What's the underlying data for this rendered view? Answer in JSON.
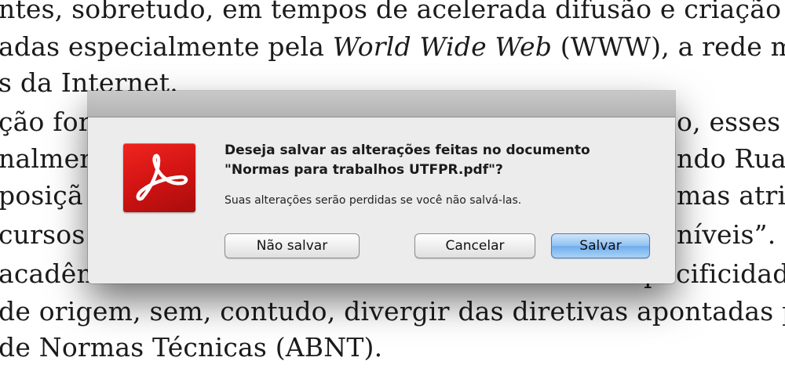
{
  "document": {
    "lines": [
      "ntes, sobretudo, em tempos de acelerada difusão e criação de",
      "adas especialmente pela ",
      "World Wide Web",
      " (WWW), a rede m",
      "s da Internet.",
      "ção for",
      "o, esses",
      "nalmen",
      "ndo Rua",
      "posiçã",
      "mas atrib",
      " cursos",
      "níveis”.",
      " acadêm",
      "pecificidade",
      "de origem, sem, contudo, divergir das diretivas apontadas pel",
      " de Normas Técnicas (ABNT)."
    ]
  },
  "dialog": {
    "message_line1": "Deseja salvar as alterações feitas no documento",
    "message_line2": "\"Normas para trabalhos UTFPR.pdf\"?",
    "informative_text": "Suas alterações serão perdidas se você não salvá-las.",
    "icon": "adobe-acrobat-icon",
    "buttons": {
      "dont_save": "Não salvar",
      "cancel": "Cancelar",
      "save": "Salvar"
    }
  },
  "colors": {
    "icon_red": "#d41515",
    "default_button_blue": "#7db5ee"
  }
}
